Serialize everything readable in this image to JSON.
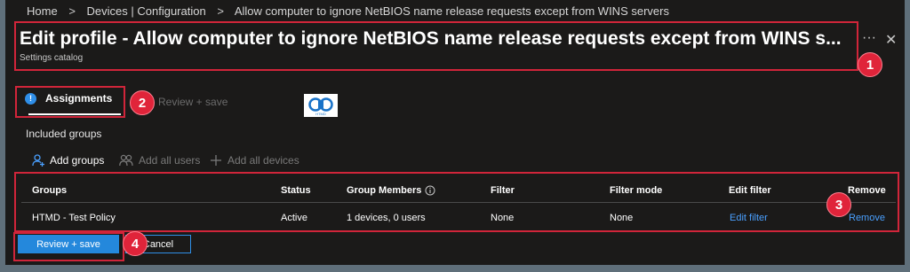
{
  "breadcrumb": {
    "items": [
      "Home",
      "Devices | Configuration",
      "Allow computer to ignore NetBIOS name release requests except from WINS servers"
    ],
    "separator": ">"
  },
  "header": {
    "title": "Edit profile - Allow computer to ignore NetBIOS name release requests except from WINS s...",
    "subtitle": "Settings catalog",
    "more_glyph": "···",
    "close_glyph": "✕"
  },
  "tabs": {
    "assignments": "Assignments",
    "review_save": "Review + save"
  },
  "included_groups_label": "Included groups",
  "toolbar": {
    "add_groups": "Add groups",
    "add_all_users": "Add all users",
    "add_all_devices": "Add all devices"
  },
  "table": {
    "headers": {
      "groups": "Groups",
      "status": "Status",
      "group_members": "Group Members",
      "filter": "Filter",
      "filter_mode": "Filter mode",
      "edit_filter": "Edit filter",
      "remove": "Remove"
    },
    "rows": [
      {
        "group": "HTMD - Test Policy",
        "status": "Active",
        "members": "1 devices, 0 users",
        "filter": "None",
        "filter_mode": "None",
        "edit_filter": "Edit filter",
        "remove": "Remove"
      }
    ]
  },
  "footer": {
    "review_save": "Review + save",
    "cancel": "Cancel"
  },
  "annotations": [
    "1",
    "2",
    "3",
    "4"
  ],
  "logo_text": "HTMD",
  "colors": {
    "background": "#1b1a19",
    "accent": "#2488dc",
    "link": "#4aa0ff",
    "annotation_red": "#d1253a"
  }
}
